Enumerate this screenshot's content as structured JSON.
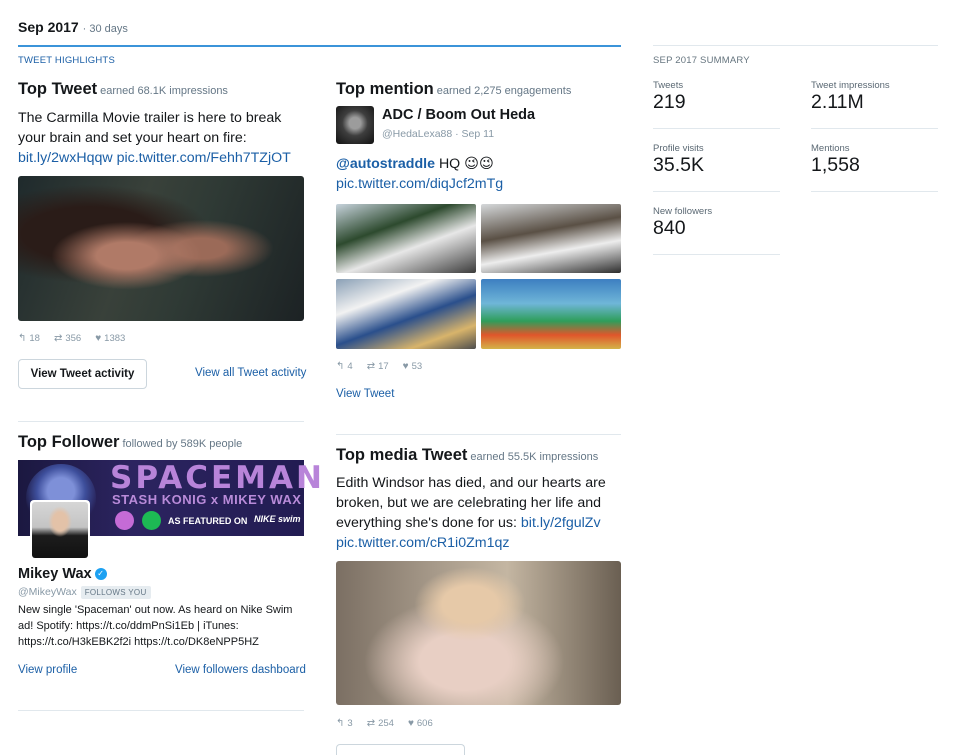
{
  "header": {
    "month": "Sep 2017",
    "period": "· 30 days"
  },
  "highlights_label": "TWEET HIGHLIGHTS",
  "summary_label": "SEP 2017 SUMMARY",
  "summary": [
    {
      "label": "Tweets",
      "value": "219"
    },
    {
      "label": "Tweet impressions",
      "value": "2.11M"
    },
    {
      "label": "Profile visits",
      "value": "35.5K"
    },
    {
      "label": "Mentions",
      "value": "1,558"
    },
    {
      "label": "New followers",
      "value": "840"
    }
  ],
  "top_tweet": {
    "title": "Top Tweet",
    "earned": "earned 68.1K impressions",
    "text": "The Carmilla Movie trailer is here to break your brain and set your heart on fire:",
    "link1": "bit.ly/2wxHqqw",
    "link2": "pic.twitter.com/Fehh7TZjOT",
    "replies": "18",
    "retweets": "356",
    "likes": "1383",
    "button": "View Tweet activity",
    "view_all": "View all Tweet activity"
  },
  "top_mention": {
    "title": "Top mention",
    "earned": "earned 2,275 engagements",
    "name": "ADC / Boom Out Heda",
    "handle": "@HedaLexa88 · Sep 11",
    "mention": "@autostraddle",
    "text_after": "HQ 😉😉",
    "link": "pic.twitter.com/diqJcf2mTg",
    "replies": "4",
    "retweets": "17",
    "likes": "53",
    "view_tweet": "View Tweet"
  },
  "top_follower": {
    "title": "Top Follower",
    "followed_by": "followed by 589K people",
    "banner_title": "SPACEMAN",
    "banner_sub": "STASH KONIG x MIKEY WAX",
    "banner_featured": "AS FEATURED ON",
    "banner_brand": "NIKE swim",
    "name": "Mikey Wax",
    "handle": "@MikeyWax",
    "follows_you": "FOLLOWS YOU",
    "bio": "New single 'Spaceman' out now. As heard on Nike Swim ad! Spotify: https://t.co/ddmPnSi1Eb | iTunes: https://t.co/H3kEBK2f2i https://t.co/DK8eNPP5HZ",
    "view_profile": "View profile",
    "view_dashboard": "View followers dashboard"
  },
  "top_media": {
    "title": "Top media Tweet",
    "earned": "earned 55.5K impressions",
    "text": "Edith Windsor has died, and our hearts are broken, but we are celebrating her life and everything she's done for us:",
    "link1": "bit.ly/2fgulZv",
    "link2": "pic.twitter.com/cR1i0Zm1qz",
    "replies": "3",
    "retweets": "254",
    "likes": "606"
  },
  "icons": {
    "reply": "reply-icon",
    "retweet": "retweet-icon",
    "like": "heart-icon",
    "verified": "verified-badge-icon"
  }
}
